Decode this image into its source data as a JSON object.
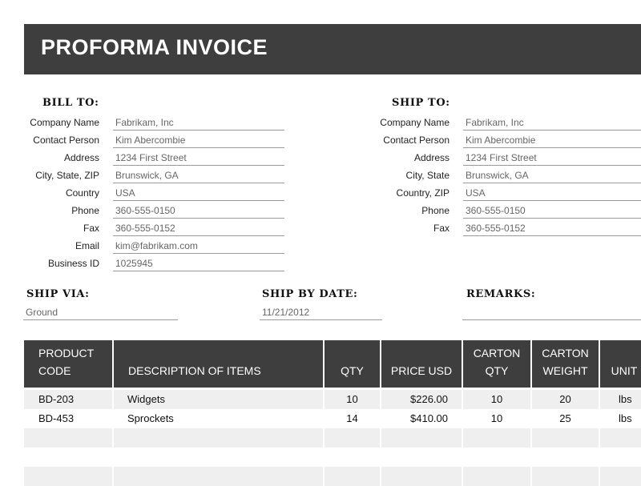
{
  "title": "PROFORMA INVOICE",
  "bill_to": {
    "heading": "BILL TO:",
    "fields": [
      {
        "label": "Company Name",
        "value": "Fabrikam, Inc"
      },
      {
        "label": "Contact Person",
        "value": "Kim Abercombie"
      },
      {
        "label": "Address",
        "value": "1234 First Street"
      },
      {
        "label": "City, State, ZIP",
        "value": "Brunswick, GA"
      },
      {
        "label": "Country",
        "value": "USA"
      },
      {
        "label": "Phone",
        "value": "360-555-0150"
      },
      {
        "label": "Fax",
        "value": "360-555-0152"
      },
      {
        "label": "Email",
        "value": "kim@fabrikam.com"
      },
      {
        "label": "Business ID",
        "value": "1025945"
      }
    ]
  },
  "ship_to": {
    "heading": "SHIP TO:",
    "fields": [
      {
        "label": "Company Name",
        "value": "Fabrikam, Inc"
      },
      {
        "label": "Contact Person",
        "value": "Kim Abercombie"
      },
      {
        "label": "Address",
        "value": "1234 First Street"
      },
      {
        "label": "City, State",
        "value": "Brunswick, GA"
      },
      {
        "label": "Country, ZIP",
        "value": "USA"
      },
      {
        "label": "Phone",
        "value": "360-555-0150"
      },
      {
        "label": "Fax",
        "value": "360-555-0152"
      }
    ]
  },
  "ship_via": {
    "heading": "SHIP VIA:",
    "value": "Ground"
  },
  "ship_by_date": {
    "heading": "SHIP BY DATE:",
    "value": "11/21/2012"
  },
  "remarks": {
    "heading": "REMARKS:",
    "value": ""
  },
  "table": {
    "headers": {
      "product_code": [
        "PRODUCT",
        "CODE"
      ],
      "description": "DESCRIPTION OF ITEMS",
      "qty": "QTY",
      "price": "PRICE USD",
      "carton_qty": [
        "CARTON",
        "QTY"
      ],
      "carton_weight": [
        "CARTON",
        "WEIGHT"
      ],
      "unit": "UNIT"
    },
    "rows": [
      {
        "code": "BD-203",
        "description": "Widgets",
        "qty": "10",
        "price": "$226.00",
        "carton_qty": "10",
        "carton_weight": "20",
        "unit": "lbs"
      },
      {
        "code": "BD-453",
        "description": "Sprockets",
        "qty": "14",
        "price": "$410.00",
        "carton_qty": "10",
        "carton_weight": "25",
        "unit": "lbs"
      },
      {
        "code": "",
        "description": "",
        "qty": "",
        "price": "",
        "carton_qty": "",
        "carton_weight": "",
        "unit": ""
      },
      {
        "code": "",
        "description": "",
        "qty": "",
        "price": "",
        "carton_qty": "",
        "carton_weight": "",
        "unit": ""
      },
      {
        "code": "",
        "description": "",
        "qty": "",
        "price": "",
        "carton_qty": "",
        "carton_weight": "",
        "unit": ""
      }
    ]
  },
  "colors": {
    "header_bg": "#3e3e3e",
    "stripe": "#efefef",
    "header_text": "#ffffff"
  }
}
